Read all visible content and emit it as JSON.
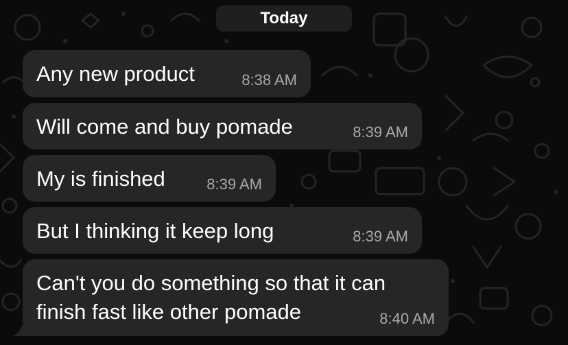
{
  "date_separator": "Today",
  "messages": [
    {
      "text": "Any new product",
      "time": "8:38 AM"
    },
    {
      "text": "Will come and buy pomade",
      "time": "8:39 AM"
    },
    {
      "text": "My is finished",
      "time": "8:39 AM"
    },
    {
      "text": "But I thinking it keep long",
      "time": "8:39 AM"
    },
    {
      "text_line1": "Can't you do something so that it can",
      "text_line2": "finish fast like other pomade",
      "time": "8:40 AM"
    }
  ],
  "colors": {
    "background": "#0b0b0b",
    "bubble": "#262626",
    "timestamp": "#a9a9a9",
    "date_chip": "#1f1f1f"
  }
}
